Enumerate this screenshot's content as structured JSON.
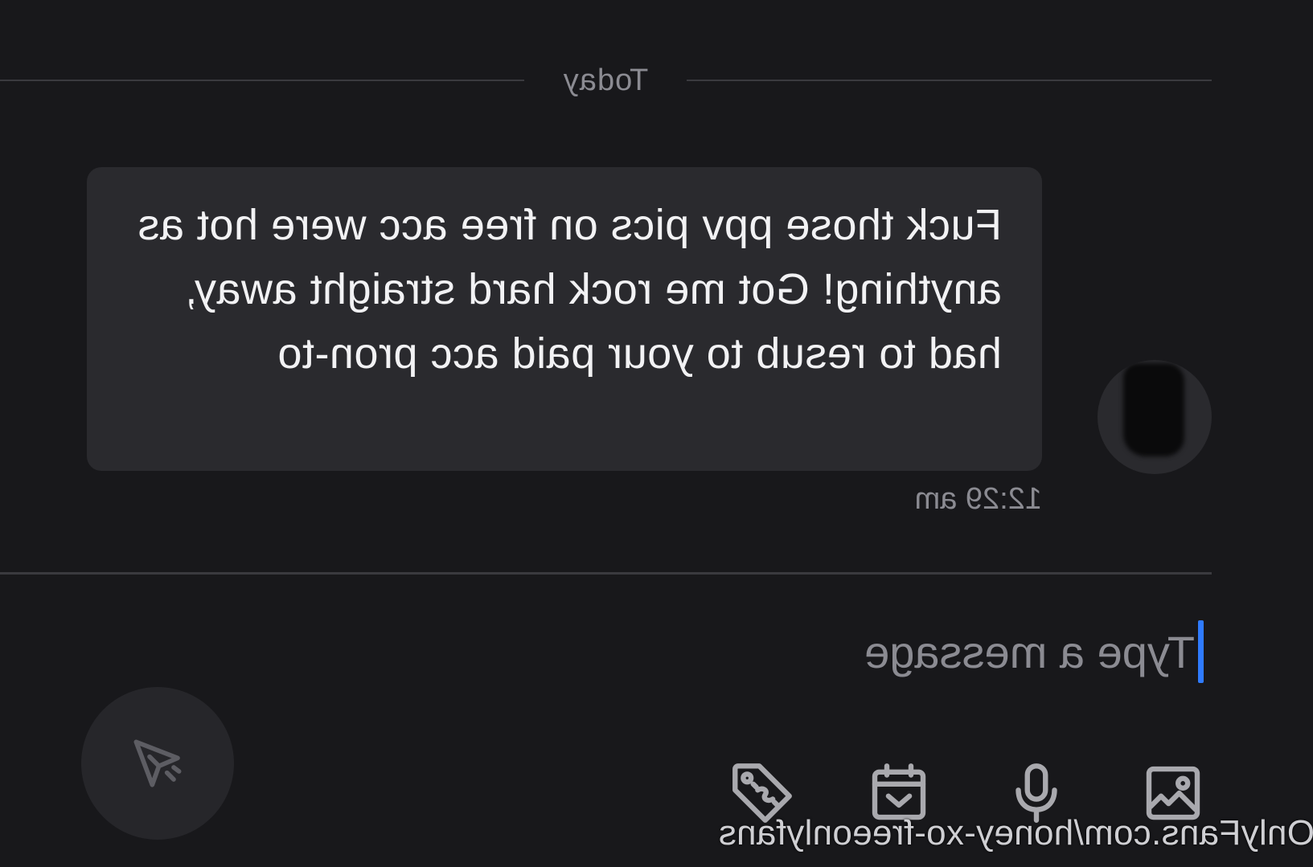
{
  "chat": {
    "date_divider": "Today",
    "message": {
      "text": "Fuck those ppv pics on free acc were hot as anything! Got me rock hard straight away, had to resub to your paid acc pron-to",
      "time": "12:29 am",
      "direction": "outgoing"
    }
  },
  "composer": {
    "placeholder": "Type a message",
    "value": "",
    "tools": [
      {
        "icon": "image-icon",
        "label": "image"
      },
      {
        "icon": "microphone-icon",
        "label": "voice"
      },
      {
        "icon": "calendar-icon",
        "label": "schedule"
      },
      {
        "icon": "price-tag-icon",
        "label": "price"
      }
    ],
    "send_icon": "send-icon"
  },
  "watermark": {
    "text": "OnlyFans.com/honey-xo-freeonlyfans"
  },
  "colors": {
    "background": "#18181b",
    "bubble": "#2a2a2e",
    "caret": "#2f7bff",
    "muted_text": "#8b8b92",
    "icon": "#a9a9ae"
  },
  "layout_note_mirrored": "true"
}
